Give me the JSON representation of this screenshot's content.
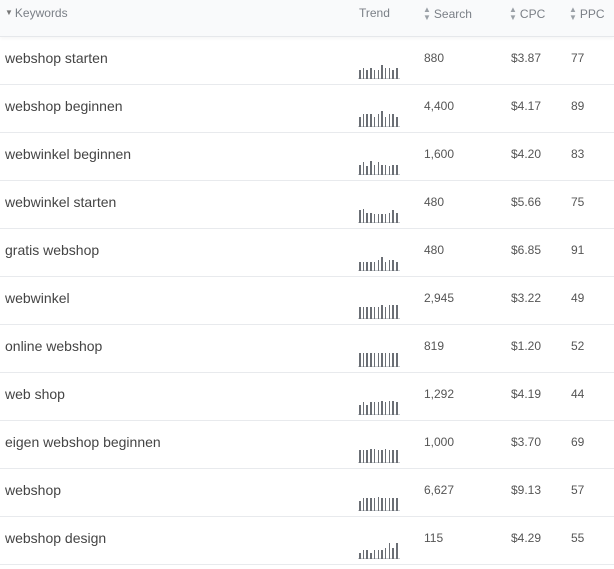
{
  "header": {
    "keywords": "Keywords",
    "trend": "Trend",
    "search": "Search",
    "cpc": "CPC",
    "ppc": "PPC",
    "sort_desc_icon": "caret-down-icon",
    "sortable_icon": "sort-icon"
  },
  "rows": [
    {
      "keyword": "webshop starten",
      "search": "880",
      "cpc": "$3.87",
      "ppc": "77",
      "trend": [
        0.55,
        0.7,
        0.55,
        0.7,
        0.55,
        0.55,
        0.85,
        0.7,
        0.7,
        0.55,
        0.7
      ]
    },
    {
      "keyword": "webshop beginnen",
      "search": "4,400",
      "cpc": "$4.17",
      "ppc": "89",
      "trend": [
        0.65,
        0.8,
        0.8,
        0.8,
        0.65,
        0.8,
        1.0,
        0.65,
        0.8,
        0.8,
        0.65
      ]
    },
    {
      "keyword": "webwinkel beginnen",
      "search": "1,600",
      "cpc": "$4.20",
      "ppc": "83",
      "trend": [
        0.65,
        0.8,
        0.55,
        0.9,
        0.65,
        0.8,
        0.65,
        0.65,
        0.55,
        0.65,
        0.65
      ]
    },
    {
      "keyword": "webwinkel starten",
      "search": "480",
      "cpc": "$5.66",
      "ppc": "75",
      "trend": [
        0.8,
        0.9,
        0.65,
        0.65,
        0.55,
        0.55,
        0.55,
        0.55,
        0.65,
        0.8,
        0.65
      ]
    },
    {
      "keyword": "gratis webshop",
      "search": "480",
      "cpc": "$6.85",
      "ppc": "91",
      "trend": [
        0.55,
        0.55,
        0.55,
        0.55,
        0.55,
        0.7,
        0.9,
        0.55,
        0.7,
        0.7,
        0.55
      ]
    },
    {
      "keyword": "webwinkel",
      "search": "2,945",
      "cpc": "$3.22",
      "ppc": "49",
      "trend": [
        0.75,
        0.75,
        0.75,
        0.75,
        0.75,
        0.75,
        0.9,
        0.75,
        0.9,
        0.9,
        0.9
      ]
    },
    {
      "keyword": "online webshop",
      "search": "819",
      "cpc": "$1.20",
      "ppc": "52",
      "trend": [
        0.85,
        0.85,
        0.85,
        0.85,
        0.85,
        0.85,
        0.85,
        0.85,
        0.85,
        0.85,
        0.85
      ]
    },
    {
      "keyword": "web shop",
      "search": "1,292",
      "cpc": "$4.19",
      "ppc": "44",
      "trend": [
        0.65,
        0.8,
        0.65,
        0.8,
        0.8,
        0.8,
        0.9,
        0.8,
        0.9,
        0.9,
        0.8
      ]
    },
    {
      "keyword": "eigen webshop beginnen",
      "search": "1,000",
      "cpc": "$3.70",
      "ppc": "69",
      "trend": [
        0.8,
        0.8,
        0.8,
        0.9,
        0.9,
        0.8,
        0.8,
        0.9,
        0.8,
        0.8,
        0.8
      ]
    },
    {
      "keyword": "webshop",
      "search": "6,627",
      "cpc": "$9.13",
      "ppc": "57",
      "trend": [
        0.65,
        0.8,
        0.8,
        0.8,
        0.8,
        0.9,
        0.8,
        0.8,
        0.8,
        0.8,
        0.8
      ]
    },
    {
      "keyword": "webshop design",
      "search": "115",
      "cpc": "$4.29",
      "ppc": "55",
      "trend": [
        0.4,
        0.55,
        0.55,
        0.4,
        0.55,
        0.55,
        0.55,
        0.7,
        1.0,
        0.7,
        1.0
      ]
    }
  ]
}
